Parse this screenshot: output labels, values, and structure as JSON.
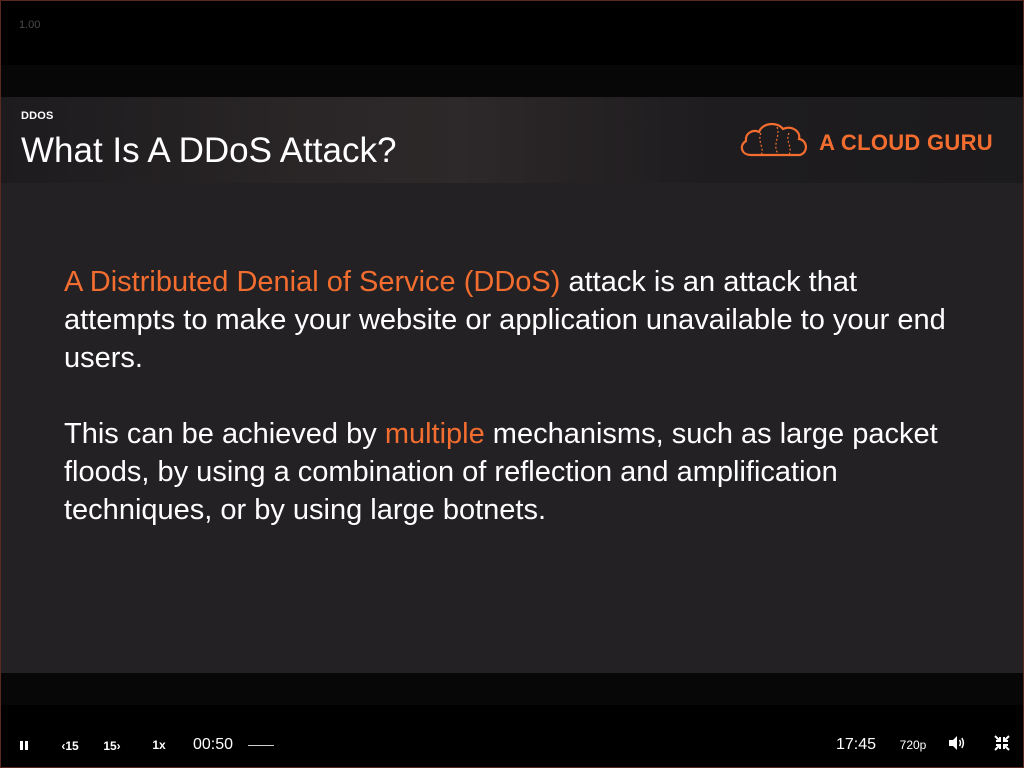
{
  "player": {
    "zoom": "1.00",
    "controls": {
      "back_label": "15",
      "forward_label": "15",
      "speed": "1x",
      "current_time": "00:50",
      "total_time": "17:45",
      "quality": "720p"
    }
  },
  "slide": {
    "section": "DDOS",
    "title": "What Is A DDoS Attack?",
    "logo_text": "A CLOUD GURU",
    "paragraph1": {
      "highlight": "A Distributed Denial of Service (DDoS)",
      "rest": " attack is an attack that attempts to make your website or application unavailable to your end users."
    },
    "paragraph2": {
      "before": "This can be achieved by ",
      "highlight": "multiple",
      "after": " mechanisms, such as large packet floods, by using a combination of reflection and amplification techniques, or by using large botnets."
    }
  },
  "colors": {
    "accent": "#f26d2f",
    "slide_bg": "#232124",
    "text": "#ffffff"
  },
  "icons": [
    "cloud-logo-icon",
    "pause-icon",
    "skip-back-icon",
    "skip-forward-icon",
    "volume-icon",
    "exit-fullscreen-icon"
  ]
}
